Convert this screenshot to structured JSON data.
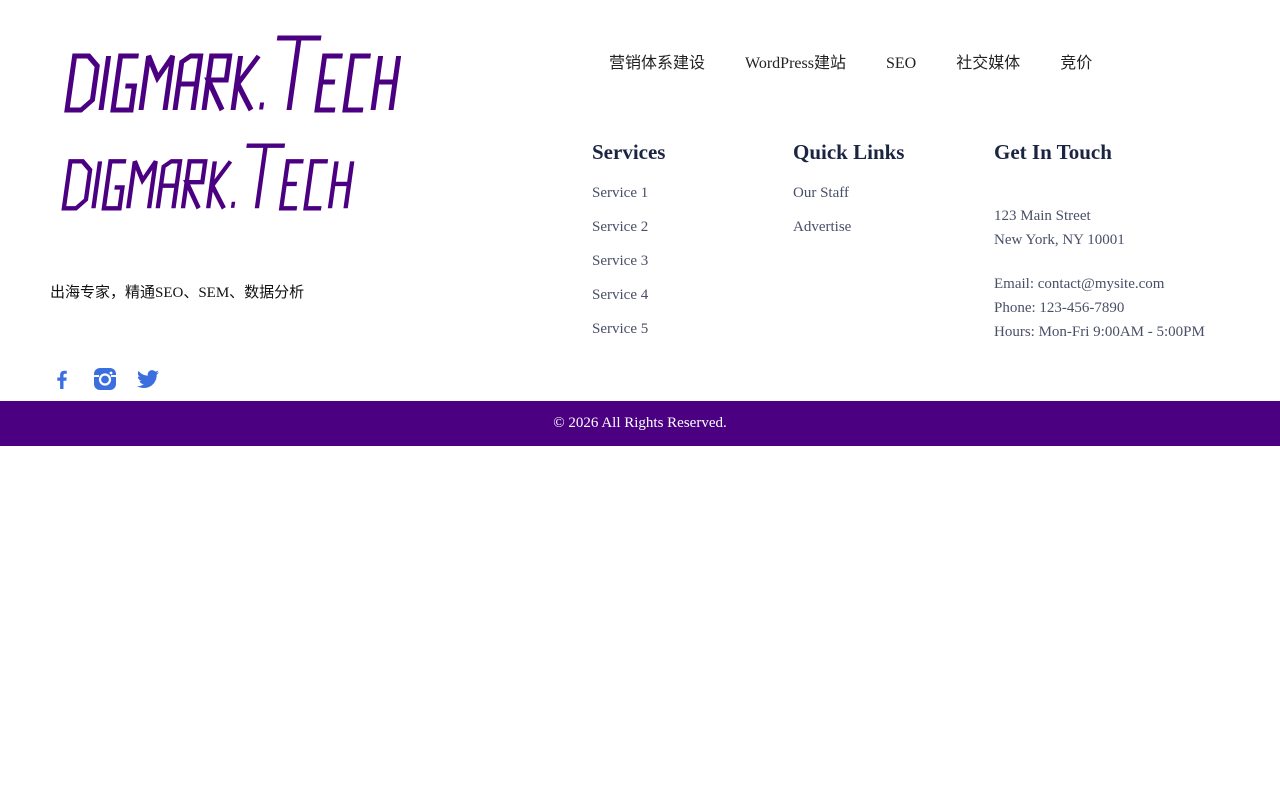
{
  "brand": {
    "logo_text": "DIGMARK.TECH",
    "logo_color": "#4b0082"
  },
  "nav": {
    "items": [
      {
        "label": "营销体系建设"
      },
      {
        "label": "WordPress建站"
      },
      {
        "label": "SEO"
      },
      {
        "label": "社交媒体"
      },
      {
        "label": "竞价"
      }
    ]
  },
  "tagline": "出海专家，精通SEO、SEM、数据分析",
  "social": {
    "icons": [
      "facebook-icon",
      "instagram-icon",
      "twitter-icon"
    ],
    "icon_color": "#3b6fe0"
  },
  "services": {
    "title": "Services",
    "items": [
      "Service 1",
      "Service 2",
      "Service 3",
      "Service 4",
      "Service 5"
    ]
  },
  "quick_links": {
    "title": "Quick Links",
    "items": [
      "Our Staff",
      "Advertise"
    ]
  },
  "contact": {
    "title": "Get In Touch",
    "address_line1": "123 Main Street",
    "address_line2": "New York, NY 10001",
    "email": "Email: contact@mysite.com",
    "phone": "Phone: 123-456-7890",
    "hours": "Hours: Mon-Fri 9:00AM - 5:00PM"
  },
  "footer": {
    "copyright": "© 2026 All Rights Reserved.",
    "bar_color": "#4b0082"
  }
}
